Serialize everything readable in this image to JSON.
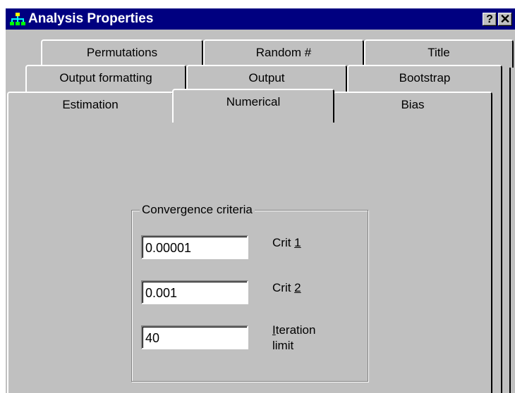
{
  "window": {
    "title": "Analysis Properties",
    "help_glyph": "?",
    "close_glyph": "✕"
  },
  "tabs": {
    "row1": [
      "Permutations",
      "Random #",
      "Title"
    ],
    "row2": [
      "Output formatting",
      "Output",
      "Bootstrap"
    ],
    "row3": [
      "Estimation",
      "Numerical",
      "Bias"
    ],
    "active": "Numerical"
  },
  "convergence": {
    "group_label": "Convergence criteria",
    "fields": [
      {
        "value": "0.00001",
        "label_prefix": "Crit ",
        "label_accel": "1",
        "label_suffix": ""
      },
      {
        "value": "0.001",
        "label_prefix": "Crit ",
        "label_accel": "2",
        "label_suffix": ""
      },
      {
        "value": "40",
        "label_prefix": "",
        "label_accel": "I",
        "label_suffix": "teration",
        "label_line2": "limit"
      }
    ]
  },
  "colors": {
    "titlebar": "#000080",
    "face": "#c0c0c0"
  },
  "icons": {
    "app": "network-icon"
  }
}
